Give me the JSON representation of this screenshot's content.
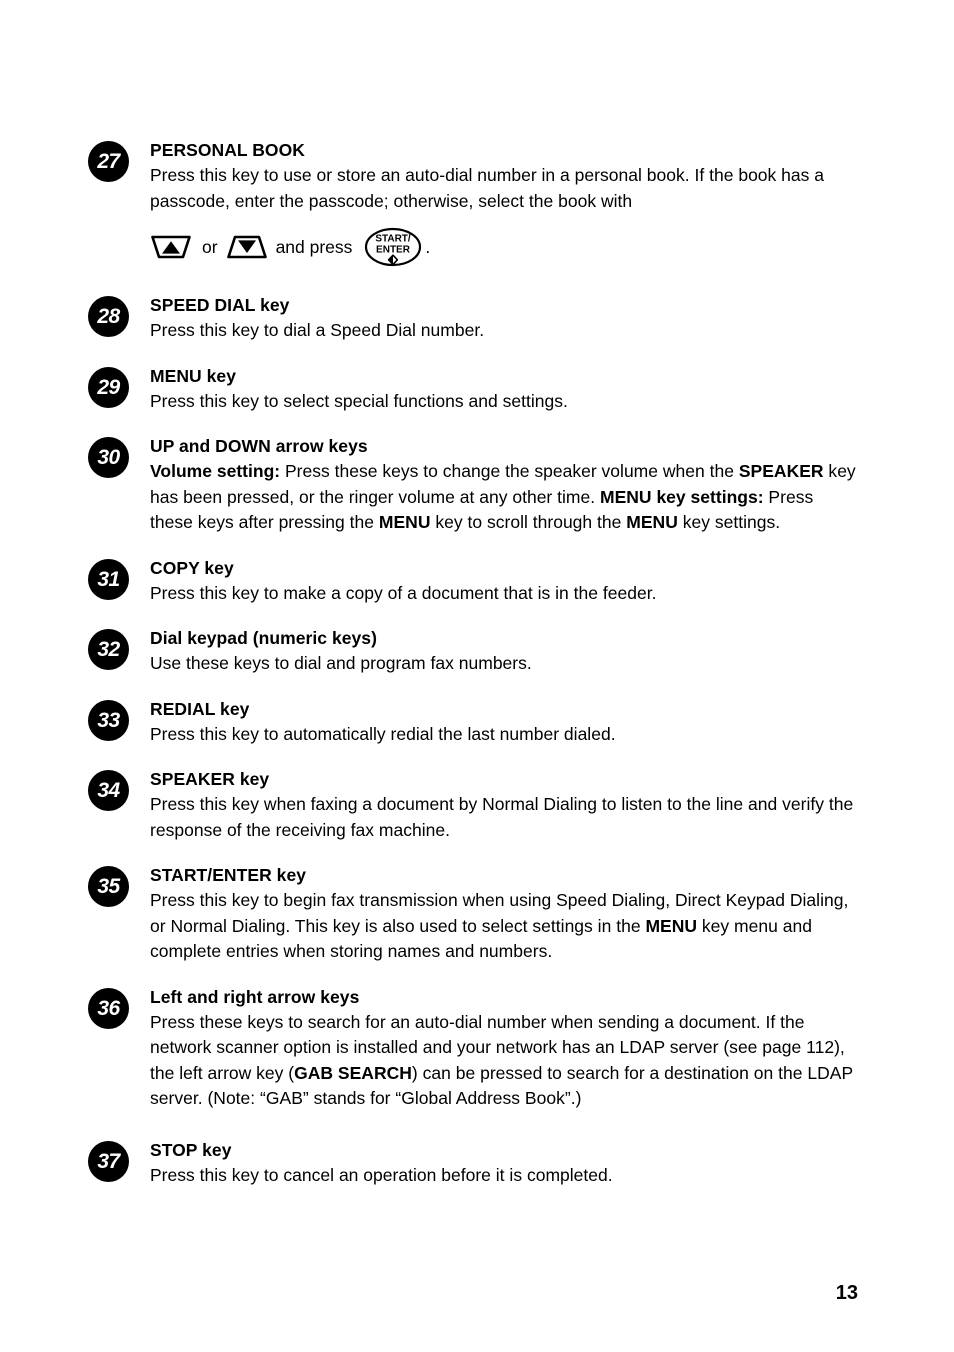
{
  "document": {
    "page_number": "13",
    "ink_color": "#000000",
    "paper_color": "#ffffff"
  },
  "entries": [
    {
      "number": "27",
      "title": "PERSONAL BOOK",
      "body": "Press this key to use or store an auto-dial number in a personal book. If the book has a passcode, enter the passcode; otherwise, select the book with",
      "icon_line": {
        "up_key_icon": "up-arrow-key-icon",
        "or_label": "or",
        "down_key_icon": "down-arrow-key-icon",
        "and_press_label": "and press",
        "start_enter_key": {
          "line1": "START/",
          "line2": "ENTER",
          "symbol": "start-diamond-icon"
        },
        "terminator": "."
      }
    },
    {
      "number": "28",
      "title": "SPEED DIAL key",
      "body": "Press this key to dial a Speed Dial number."
    },
    {
      "number": "29",
      "title": "MENU key",
      "body": "Press this key to select special functions and settings."
    },
    {
      "number": "30",
      "title": "UP and DOWN arrow keys",
      "body_html": "<b>Volume setting:</b> Press these keys to change the speaker volume when the <b>SPEAKER</b> key has been pressed, or the ringer volume at any other time. <b>MENU key settings:</b> Press these keys after pressing the <b>MENU</b> key to scroll through the <b>MENU</b> key settings."
    },
    {
      "number": "31",
      "title": "COPY key",
      "body": "Press this key to make a copy of a document that is in the feeder."
    },
    {
      "number": "32",
      "title": "Dial keypad (numeric keys)",
      "body": "Use these keys to dial and program fax numbers."
    },
    {
      "number": "33",
      "title": "REDIAL key",
      "body": "Press this key to automatically redial the last number dialed."
    },
    {
      "number": "34",
      "title": "SPEAKER key",
      "body": "Press this key when faxing a document by Normal Dialing to listen to the line and verify the response of the receiving fax machine."
    },
    {
      "number": "35",
      "title": "START/ENTER key",
      "body_html": "Press this key to begin fax transmission when using Speed Dialing, Direct Keypad Dialing, or Normal Dialing. This key is also used to select settings in the <b>MENU</b> key menu and complete entries when storing names and numbers."
    },
    {
      "number": "36",
      "title": "Left and right arrow keys",
      "body_html": "Press these keys to search for an auto-dial number when sending a document. If the network scanner option is installed and your network has an LDAP server (see page 112), the left arrow key (<b>GAB SEARCH</b>) can be pressed to search for a destination on the LDAP server. (Note: &ldquo;GAB&rdquo; stands for &ldquo;Global Address Book&rdquo;.)"
    },
    {
      "number": "37",
      "title": "STOP key",
      "body": "Press this key to cancel an operation before it is completed."
    }
  ]
}
